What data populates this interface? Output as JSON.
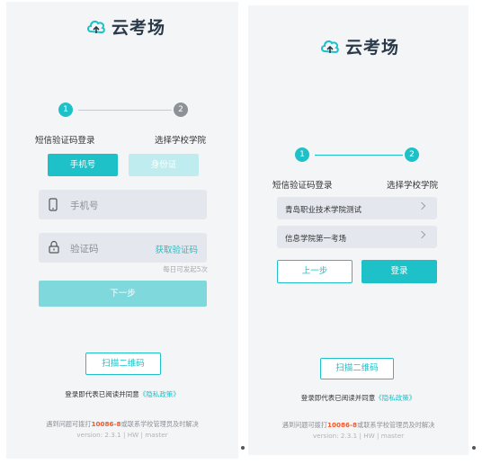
{
  "left_screen": {
    "logo_text": "云考场",
    "steps": [
      {
        "num": "1",
        "label": "短信验证码登录"
      },
      {
        "num": "2",
        "label": "选择学校学院"
      }
    ],
    "tabs": [
      {
        "label": "手机号"
      },
      {
        "label": "身份证"
      }
    ],
    "phone_placeholder": "手机号",
    "code_placeholder": "验证码",
    "get_code_label": "获取验证码",
    "daily_limit_hint": "每日可发起5次",
    "next_label": "下一步",
    "scan_label": "扫描二维码",
    "agreement_prefix": "登录即代表已阅读并同意",
    "agreement_link": "《隐私政策》",
    "footer_prefix": "遇到问题可拨打",
    "footer_phone": "10086-8",
    "footer_suffix": "或联系学校管理员及时解决",
    "version": "version: 2.3.1 | HW | master"
  },
  "right_screen": {
    "logo_text": "云考场",
    "steps": [
      {
        "num": "1",
        "label": "短信验证码登录"
      },
      {
        "num": "2",
        "label": "选择学校学院"
      }
    ],
    "items": [
      {
        "label": "青岛职业技术学院测试"
      },
      {
        "label": "信息学院第一考场"
      }
    ],
    "prev_label": "上一步",
    "login_label": "登录",
    "scan_label": "扫描二维码",
    "agreement_prefix": "登录即代表已阅读并同意",
    "agreement_link": "《隐私政策》",
    "footer_prefix": "遇到问题可拨打",
    "footer_phone": "10086-8",
    "footer_suffix": "或联系学校管理员及时解决",
    "version": "version: 2.3.1 | HW | master"
  },
  "colors": {
    "accent": "#1ec1c7",
    "accent_light": "#bfedef",
    "field_bg": "#e5e7ee",
    "hotline": "#f25a2b",
    "step_inactive": "#8e9196"
  },
  "icons": [
    "cloud-logo-icon",
    "phone-icon",
    "lock-icon",
    "chevron-right-icon"
  ]
}
